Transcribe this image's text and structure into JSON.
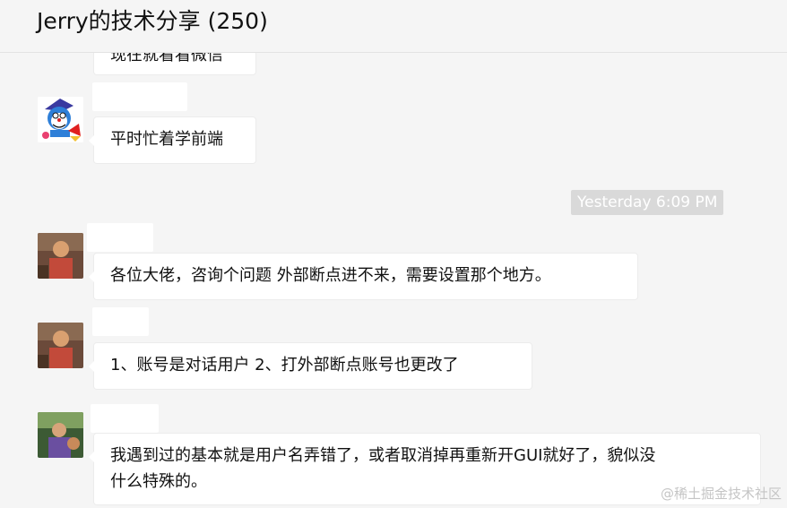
{
  "header": {
    "title": "Jerry的技术分享 (250)"
  },
  "messages": [
    {
      "text": "现在就看看微信"
    },
    {
      "text": "平时忙着学前端"
    },
    {
      "text": "各位大佬，咨询个问题 外部断点进不来，需要设置那个地方。"
    },
    {
      "text": "1、账号是对话用户 2、打外部断点账号也更改了"
    },
    {
      "text": "我遇到过的基本就是用户名弄错了，或者取消掉再重新开GUI就好了，貌似没\n什么特殊的。"
    }
  ],
  "timestamp": "Yesterday 6:09 PM",
  "watermark": "@稀土掘金技术社区"
}
